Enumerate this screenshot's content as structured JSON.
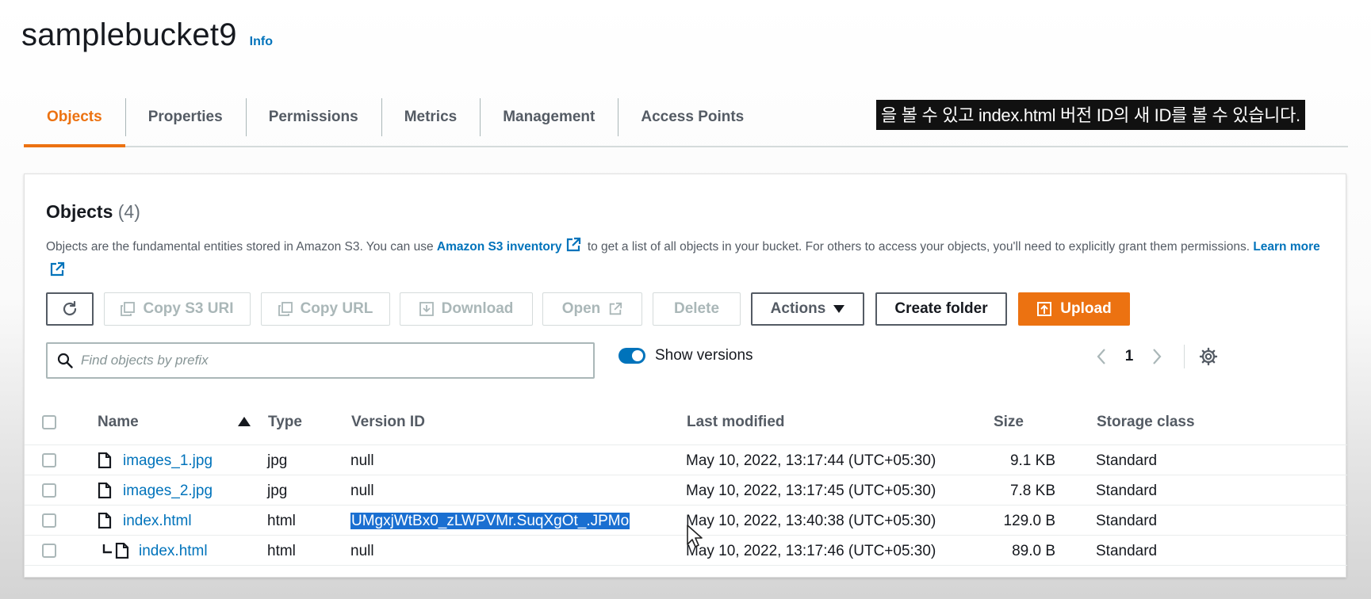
{
  "header": {
    "bucket_name": "samplebucket9",
    "info": "Info"
  },
  "tabs": [
    "Objects",
    "Properties",
    "Permissions",
    "Metrics",
    "Management",
    "Access Points"
  ],
  "active_tab": "Objects",
  "subtitle": "을 볼 수 있고 index.html 버전 ID의 새 ID를 볼 수 있습니다.",
  "panel": {
    "title": "Objects",
    "count": "(4)",
    "desc_part1": "Objects are the fundamental entities stored in Amazon S3. You can use",
    "desc_link": "Amazon S3 inventory",
    "desc_part2": "to get a list of all objects in your bucket. For others to access your objects, you'll need to explicitly grant them permissions.",
    "learn_more": "Learn more"
  },
  "toolbar": {
    "refresh_icon": "refresh-icon",
    "copy_s3_uri": "Copy S3 URI",
    "copy_url": "Copy URL",
    "download": "Download",
    "open": "Open",
    "delete": "Delete",
    "actions": "Actions",
    "create_folder": "Create folder",
    "upload": "Upload"
  },
  "search": {
    "placeholder": "Find objects by prefix",
    "value": ""
  },
  "show_versions": {
    "label": "Show versions",
    "enabled": true
  },
  "pagination": {
    "page": "1"
  },
  "table": {
    "columns": {
      "name": "Name",
      "type": "Type",
      "version": "Version ID",
      "modified": "Last modified",
      "size": "Size",
      "storage": "Storage class"
    },
    "rows": [
      {
        "name": "images_1.jpg",
        "type": "jpg",
        "version": "null",
        "modified": "May 10, 2022, 13:17:44 (UTC+05:30)",
        "size": "9.1 KB",
        "storage": "Standard"
      },
      {
        "name": "images_2.jpg",
        "type": "jpg",
        "version": "null",
        "modified": "May 10, 2022, 13:17:45 (UTC+05:30)",
        "size": "7.8 KB",
        "storage": "Standard"
      },
      {
        "name": "index.html",
        "type": "html",
        "version": "UMgxjWtBx0_zLWPVMr.SuqXgOt_.JPMo",
        "modified": "May 10, 2022, 13:40:38 (UTC+05:30)",
        "size": "129.0 B",
        "storage": "Standard"
      },
      {
        "name": "index.html",
        "type": "html",
        "version": "null",
        "modified": "May 10, 2022, 13:17:46 (UTC+05:30)",
        "size": "89.0 B",
        "storage": "Standard"
      }
    ]
  },
  "colors": {
    "accent": "#ec7211",
    "link": "#0073bb",
    "selection": "#1a6fd1"
  }
}
